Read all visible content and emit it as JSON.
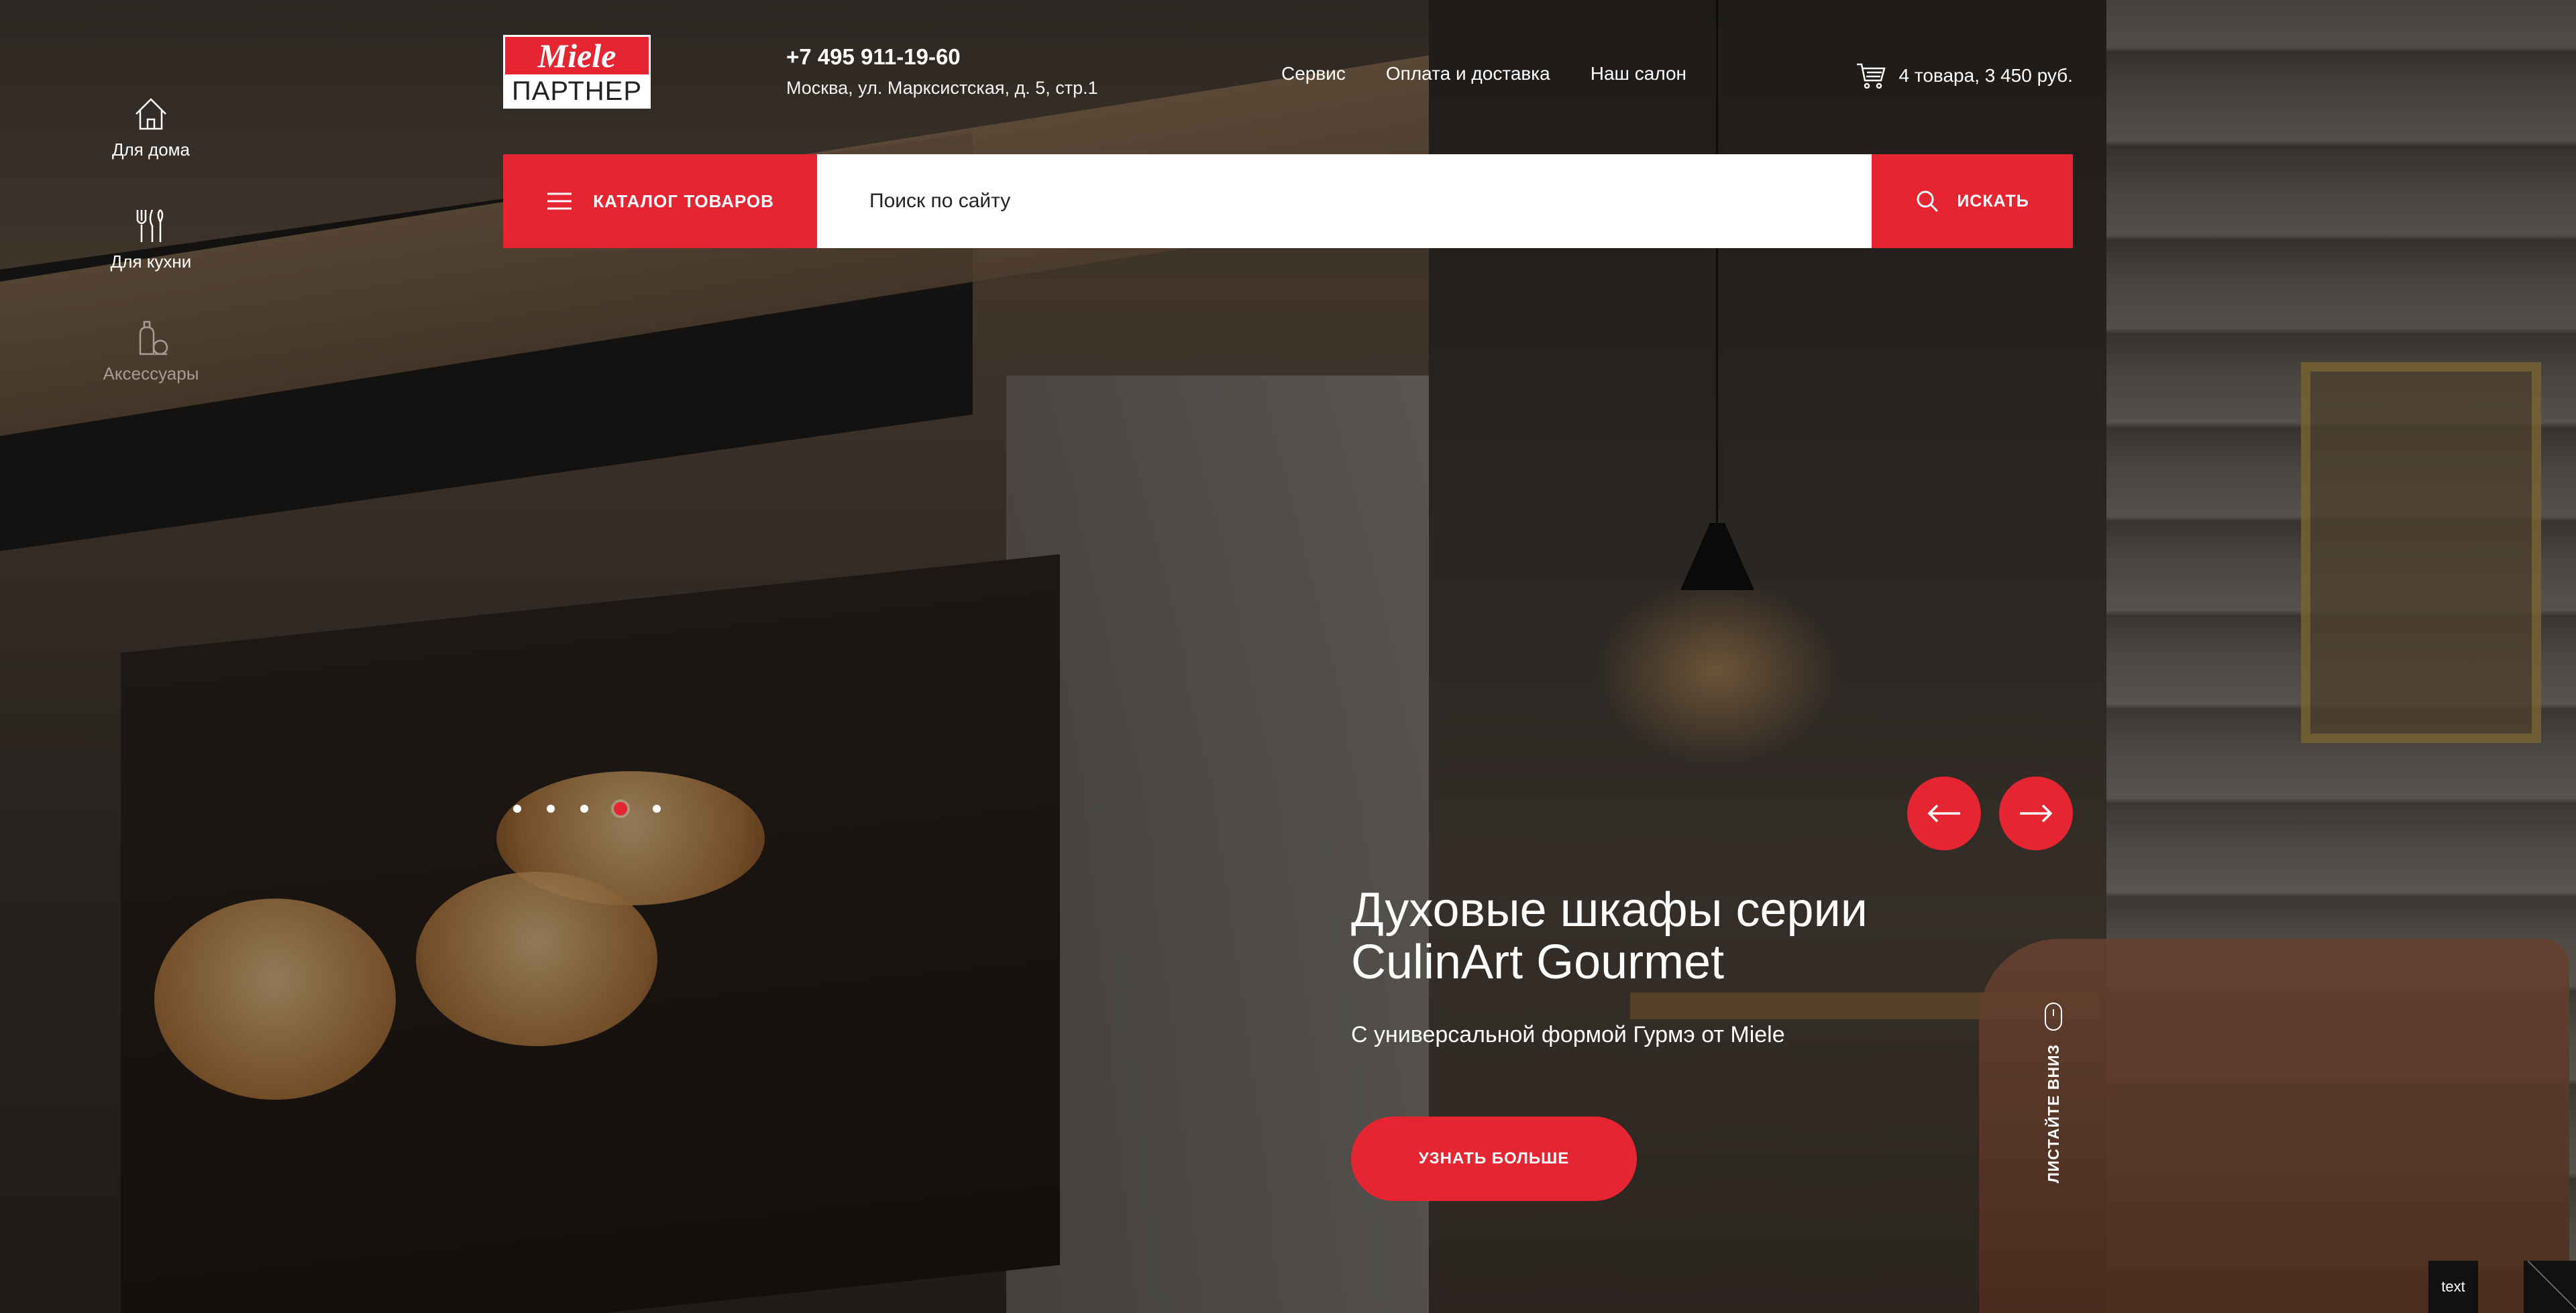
{
  "side_nav": {
    "items": [
      {
        "label": "Для дома",
        "icon": "house-icon"
      },
      {
        "label": "Для кухни",
        "icon": "cutlery-icon"
      },
      {
        "label": "Аксессуары",
        "icon": "accessories-icon"
      }
    ]
  },
  "logo": {
    "top": "Miele",
    "bottom": "ПАРТНЕР"
  },
  "contacts": {
    "phone": "+7 495 911-19-60",
    "address": "Москва, ул. Марксистская, д. 5, стр.1"
  },
  "top_links": [
    "Сервис",
    "Оплата и доставка",
    "Наш салон"
  ],
  "cart": {
    "summary": "4 товара, 3 450 руб.",
    "icon": "cart-icon"
  },
  "search": {
    "catalog_label": "КАТАЛОГ ТОВАРОВ",
    "placeholder": "Поиск по сайту",
    "button_label": "ИСКАТЬ"
  },
  "slider": {
    "dot_count": 5,
    "active_index": 3,
    "title_line1": "Духовые шкафы серии",
    "title_line2": "CulinArt Gourmet",
    "subtitle": "С универсальной формой Гурмэ от Miele",
    "cta_label": "УЗНАТЬ БОЛЬШЕ"
  },
  "scroll_hint": "ЛИСТАЙТЕ ВНИЗ",
  "badge": "text",
  "colors": {
    "accent": "#e52531",
    "white": "#ffffff"
  }
}
